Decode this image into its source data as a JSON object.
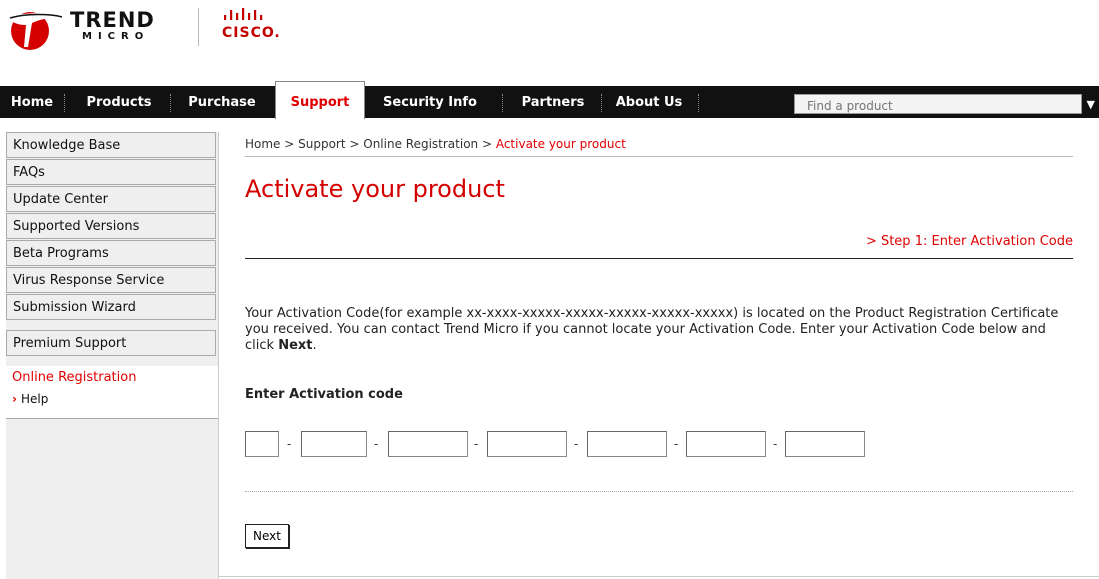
{
  "brand": {
    "trend_top": "TREND",
    "trend_bottom": "MICRO",
    "tm_mark": "™",
    "cisco": "CISCO."
  },
  "nav": {
    "items": [
      "Home",
      "Products",
      "Purchase",
      "Support",
      "Security Info",
      "Partners",
      "About Us"
    ],
    "active": "Support",
    "search_placeholder": "Find a product"
  },
  "sidebar": {
    "items": [
      "Knowledge Base",
      "FAQs",
      "Update Center",
      "Supported Versions",
      "Beta Programs",
      "Virus Response Service",
      "Submission Wizard",
      "Premium Support"
    ],
    "online_registration": "Online Registration",
    "help": "Help"
  },
  "breadcrumb": {
    "home": "Home",
    "sep": " > ",
    "support": "Support",
    "online_registration": "Online Registration",
    "current": "Activate your product"
  },
  "page": {
    "title": "Activate your product",
    "step": "> Step 1: Enter Activation Code",
    "instructions_pre": "Your Activation Code(for example xx-xxxx-xxxxx-xxxxx-xxxxx-xxxxx-xxxxx) is located on the Product Registration Certificate you received. You can contact Trend Micro if you cannot locate your Activation Code. Enter your Activation Code below and click ",
    "instructions_bold": "Next",
    "instructions_post": ".",
    "label": "Enter Activation code",
    "dash": "-",
    "next_button": "Next"
  },
  "colors": {
    "accent_red": "#e00000",
    "nav_bg": "#111111",
    "sidebar_bg": "#efefef"
  }
}
